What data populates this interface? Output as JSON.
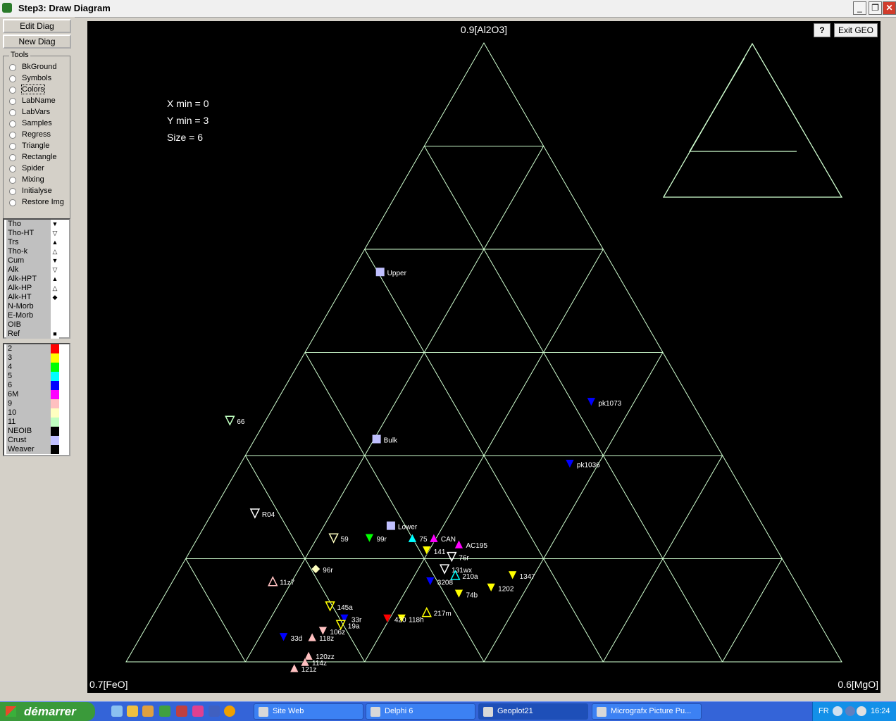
{
  "window": {
    "title": "Step3: Draw Diagram",
    "minimize": "_",
    "restore": "❐",
    "close": "✕"
  },
  "left_panel": {
    "edit_diag": "Edit Diag",
    "new_diag": "New Diag",
    "tools_title": "Tools",
    "tools": [
      "BkGround",
      "Symbols",
      "Colors",
      "LabName",
      "LabVars",
      "Samples",
      "Regress",
      "Triangle",
      "Rectangle",
      "Spider",
      "Mixing",
      "Initialyse",
      "Restore Img"
    ],
    "series_list": [
      {
        "label": "Tho",
        "symbol": "▼"
      },
      {
        "label": "Tho-HT",
        "symbol": "▽"
      },
      {
        "label": "Trs",
        "symbol": "▲"
      },
      {
        "label": "Tho-k",
        "symbol": "△"
      },
      {
        "label": "Cum",
        "symbol": "▼"
      },
      {
        "label": "Alk",
        "symbol": "▽"
      },
      {
        "label": "Alk-HPT",
        "symbol": "▲"
      },
      {
        "label": "Alk-HP",
        "symbol": "△"
      },
      {
        "label": "Alk-HT",
        "symbol": "◆"
      },
      {
        "label": "N-Morb",
        "symbol": ""
      },
      {
        "label": "E-Morb",
        "symbol": ""
      },
      {
        "label": "OIB",
        "symbol": ""
      },
      {
        "label": "Ref",
        "symbol": "■"
      }
    ],
    "color_list": [
      {
        "label": "2",
        "color": "#ff0000"
      },
      {
        "label": "3",
        "color": "#ffff00"
      },
      {
        "label": "4",
        "color": "#00ff00"
      },
      {
        "label": "5",
        "color": "#00ffff"
      },
      {
        "label": "6",
        "color": "#0000ff"
      },
      {
        "label": "6M",
        "color": "#ff00ff"
      },
      {
        "label": "9",
        "color": "#ffc0c0"
      },
      {
        "label": "10",
        "color": "#ffffc0"
      },
      {
        "label": "11",
        "color": "#c0ffc0"
      },
      {
        "label": "NEOIB",
        "color": "#000000"
      },
      {
        "label": "Crust",
        "color": "#c0c0ff"
      },
      {
        "label": "Weaver",
        "color": "#000000"
      }
    ]
  },
  "diagram": {
    "help_button": "?",
    "exit_button": "Exit GEO",
    "apex_top": "0.9[Al2O3]",
    "apex_left": "0.7[FeO]",
    "apex_right": "0.6[MgO]",
    "info": [
      "X min = 0",
      "Y min = 3",
      "Size  = 6"
    ],
    "line_color": "#d0ffd0",
    "bg_color": "#000000"
  },
  "chart_data": {
    "type": "scatter",
    "title": "",
    "axes": [
      "0.9[Al2O3]",
      "0.7[FeO]",
      "0.6[MgO]"
    ],
    "grid": true,
    "points": [
      {
        "label": "Upper",
        "a": 0.63,
        "f": 0.33,
        "sym": "square",
        "color": "#c0c0ff"
      },
      {
        "label": "Bulk",
        "a": 0.36,
        "f": 0.47,
        "sym": "square",
        "color": "#c0c0ff"
      },
      {
        "label": "Lower",
        "a": 0.22,
        "f": 0.52,
        "sym": "square",
        "color": "#c0c0ff"
      },
      {
        "label": "pk1073",
        "a": 0.42,
        "f": 0.14,
        "sym": "down",
        "color": "#0000ff"
      },
      {
        "label": "pk1036",
        "a": 0.32,
        "f": 0.22,
        "sym": "down",
        "color": "#0000ff"
      },
      {
        "label": "66",
        "a": 0.39,
        "f": 0.66,
        "sym": "down-open",
        "color": "#c0ffc0"
      },
      {
        "label": "R04",
        "a": 0.24,
        "f": 0.7,
        "sym": "down-open",
        "color": "#ffffff"
      },
      {
        "label": "59",
        "a": 0.2,
        "f": 0.61,
        "sym": "down-open",
        "color": "#ffffc0"
      },
      {
        "label": "99r",
        "a": 0.2,
        "f": 0.56,
        "sym": "down",
        "color": "#00ff00"
      },
      {
        "label": "CAN",
        "a": 0.2,
        "f": 0.47,
        "sym": "up",
        "color": "#ff00ff"
      },
      {
        "label": "AC195",
        "a": 0.19,
        "f": 0.44,
        "sym": "up",
        "color": "#ff00ff"
      },
      {
        "label": "75",
        "a": 0.2,
        "f": 0.5,
        "sym": "up",
        "color": "#00ffff"
      },
      {
        "label": "141",
        "a": 0.18,
        "f": 0.49,
        "sym": "down",
        "color": "#ffff00"
      },
      {
        "label": "76r",
        "a": 0.17,
        "f": 0.46,
        "sym": "down-open",
        "color": "#ffffff"
      },
      {
        "label": "131wx",
        "a": 0.15,
        "f": 0.48,
        "sym": "down-open",
        "color": "#ffffff"
      },
      {
        "label": "1347",
        "a": 0.14,
        "f": 0.39,
        "sym": "down",
        "color": "#ffff00"
      },
      {
        "label": "1202",
        "a": 0.12,
        "f": 0.43,
        "sym": "down",
        "color": "#ffff00"
      },
      {
        "label": "210a",
        "a": 0.14,
        "f": 0.47,
        "sym": "up-open",
        "color": "#00ffff"
      },
      {
        "label": "3208",
        "a": 0.13,
        "f": 0.51,
        "sym": "down",
        "color": "#0000ff"
      },
      {
        "label": "74b",
        "a": 0.11,
        "f": 0.48,
        "sym": "down",
        "color": "#ffff00"
      },
      {
        "label": "217m",
        "a": 0.08,
        "f": 0.54,
        "sym": "up-open",
        "color": "#ffff00"
      },
      {
        "label": "118h",
        "a": 0.07,
        "f": 0.58,
        "sym": "down",
        "color": "#ffff00"
      },
      {
        "label": "420",
        "a": 0.07,
        "f": 0.6,
        "sym": "down",
        "color": "#ff0000"
      },
      {
        "label": "11z7",
        "a": 0.13,
        "f": 0.73,
        "sym": "up-open",
        "color": "#ffc0c0"
      },
      {
        "label": "96r",
        "a": 0.15,
        "f": 0.66,
        "sym": "diamond",
        "color": "#ffffc0"
      },
      {
        "label": "145a",
        "a": 0.09,
        "f": 0.67,
        "sym": "down-open",
        "color": "#ffff00"
      },
      {
        "label": "33r",
        "a": 0.07,
        "f": 0.66,
        "sym": "down",
        "color": "#0000ff"
      },
      {
        "label": "19a",
        "a": 0.06,
        "f": 0.67,
        "sym": "down-open",
        "color": "#ffff00"
      },
      {
        "label": "106z",
        "a": 0.05,
        "f": 0.7,
        "sym": "down",
        "color": "#ffc0c0"
      },
      {
        "label": "118z",
        "a": 0.04,
        "f": 0.72,
        "sym": "up",
        "color": "#ffc0c0"
      },
      {
        "label": "120zz",
        "a": 0.01,
        "f": 0.74,
        "sym": "up",
        "color": "#ffc0c0"
      },
      {
        "label": "114z",
        "a": 0.0,
        "f": 0.75,
        "sym": "up",
        "color": "#ffc0c0"
      },
      {
        "label": "121z",
        "a": -0.01,
        "f": 0.77,
        "sym": "up",
        "color": "#ffc0c0"
      },
      {
        "label": "33d",
        "a": 0.04,
        "f": 0.76,
        "sym": "down",
        "color": "#0000ff"
      }
    ]
  }
}
